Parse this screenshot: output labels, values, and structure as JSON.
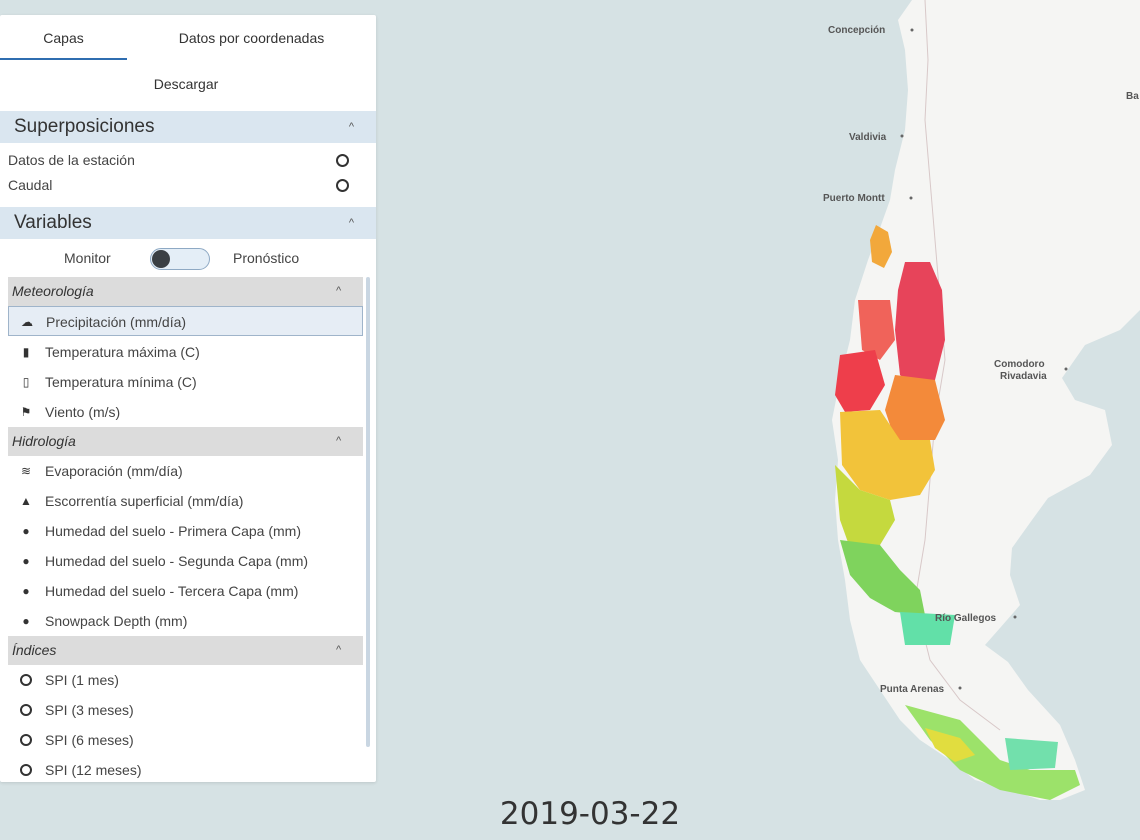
{
  "tabs": {
    "capas": "Capas",
    "coords": "Datos por coordenadas",
    "descargar": "Descargar"
  },
  "overlays": {
    "title": "Superposiciones",
    "items": [
      "Datos de la estación",
      "Caudal"
    ]
  },
  "variables": {
    "title": "Variables",
    "toggle": {
      "left": "Monitor",
      "right": "Pronóstico",
      "state": "Monitor"
    },
    "meteorologia": {
      "title": "Meteorología",
      "items": [
        "Precipitación (mm/día)",
        "Temperatura máxima (C)",
        "Temperatura mínima (C)",
        "Viento (m/s)"
      ],
      "icons": [
        "cloud-icon",
        "thermometer-icon",
        "thermometer-icon",
        "flag-icon"
      ]
    },
    "hidrologia": {
      "title": "Hidrología",
      "items": [
        "Evaporación (mm/día)",
        "Escorrentía superficial (mm/día)",
        "Humedad del suelo - Primera Capa (mm)",
        "Humedad del suelo - Segunda Capa (mm)",
        "Humedad del suelo - Tercera Capa (mm)",
        "Snowpack Depth (mm)"
      ],
      "icons": [
        "evaporation-icon",
        "runoff-icon",
        "drop-icon",
        "drop-icon",
        "drop-icon",
        "drop-icon"
      ]
    },
    "indices": {
      "title": "Índices",
      "items": [
        "SPI (1 mes)",
        "SPI (3 meses)",
        "SPI (6 meses)",
        "SPI (12 meses)"
      ]
    },
    "selected": "Precipitación (mm/día)"
  },
  "map": {
    "cities": [
      "Concepción",
      "Valdivia",
      "Puerto Montt",
      "Comodoro Rivadavia",
      "Río Gallegos",
      "Punta Arenas",
      "Ba"
    ]
  },
  "date": "2019-03-22"
}
